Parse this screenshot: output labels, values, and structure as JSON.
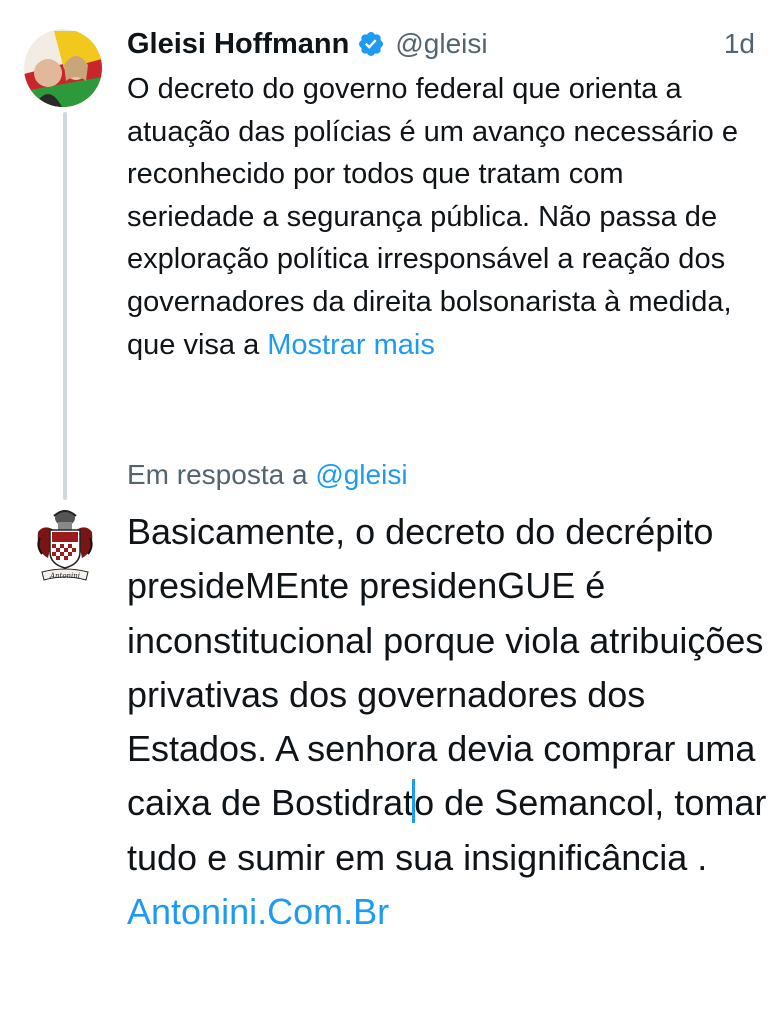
{
  "tweet": {
    "author_name": "Gleisi Hoffmann",
    "handle": "@gleisi",
    "time": "1d",
    "text": "O decreto do governo federal que orienta a atuação das polícias é um avanço necessário e reconhecido por todos que tratam com seriedade a segurança pública. Não passa de exploração política irresponsável a reação dos governadores da direita bolsonarista à medida, que visa a",
    "show_more": "Mostrar mais"
  },
  "reply": {
    "reply_to_prefix": "Em resposta a",
    "reply_to_handle": "@gleisi",
    "text_before_caret": "Basicamente, o decreto do decrépito presideMEnte presidenGUE é inconstitucional porque viola atribuições privativas dos governadores dos Estados. A senhora devia comprar uma caixa de Bostidrat",
    "text_after_caret": "o de Semancol, tomar tudo e sumir em sua insignificância . ",
    "link_text": "Antonini.Com.Br",
    "avatar_script_text": "Antonini"
  },
  "colors": {
    "text": "#0f1419",
    "secondary": "#536471",
    "link": "#1d9bf0",
    "thread_line": "#cfd9de"
  },
  "icons": [
    "verified-badge-icon"
  ]
}
